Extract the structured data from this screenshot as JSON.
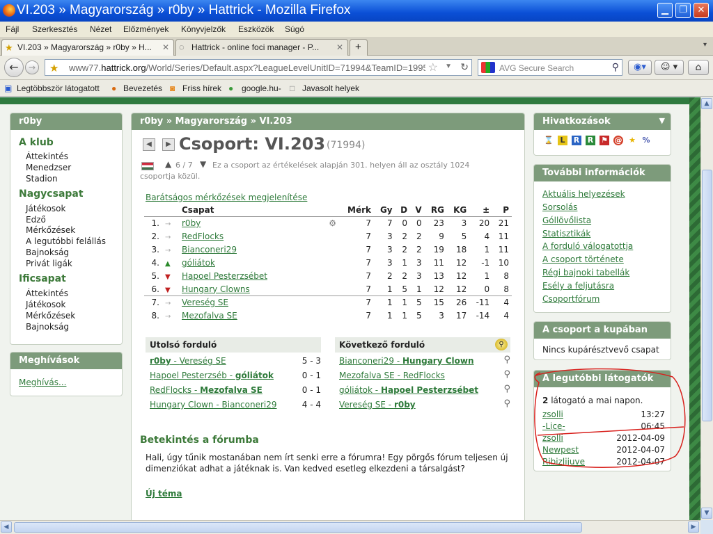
{
  "window": {
    "title": "VI.203 » Magyarország » r0by » Hattrick - Mozilla Firefox"
  },
  "menu": [
    "Fájl",
    "Szerkesztés",
    "Nézet",
    "Előzmények",
    "Könyvjelzők",
    "Eszközök",
    "Súgó"
  ],
  "tabs": [
    {
      "label": "VI.203 » Magyarország » r0by » H..."
    },
    {
      "label": "Hattrick - online foci manager - P..."
    }
  ],
  "nav": {
    "url_prefix": "www77.",
    "url_domain": "hattrick.org",
    "url_rest": "/World/Series/Default.aspx?LeagueLevelUnitID=71994&TeamID=19957",
    "search_placeholder": "AVG Secure Search"
  },
  "bookmarks": [
    "Legtöbbször látogatott",
    "Bevezetés",
    "Friss hírek",
    "google.hu-",
    "Javasolt helyek"
  ],
  "left": {
    "header": "r0by",
    "groups": [
      {
        "title": "A klub",
        "items": [
          "Áttekintés",
          "Menedzser",
          "Stadion"
        ]
      },
      {
        "title": "Nagycsapat",
        "items": [
          "Játékosok",
          "Edző",
          "Mérkőzések",
          "A legutóbbi felállás",
          "Bajnokság",
          "Privát ligák"
        ]
      },
      {
        "title": "Ificsapat",
        "items": [
          "Áttekintés",
          "Játékosok",
          "Mérkőzések",
          "Bajnokság"
        ]
      }
    ],
    "invites_header": "Meghívások",
    "invite_link": "Meghívás..."
  },
  "main": {
    "breadcrumb": "r0by  »  Magyarország  »  VI.203",
    "title": "Csoport: VI.203",
    "id": "(71994)",
    "rank_text": "6 / 7",
    "rank_desc_1": "Ez a csoport az értékelések alapján 301. helyen áll az osztály 1024",
    "rank_desc_2": "csoportja közül.",
    "friendly_link": "Barátságos mérkőzések megjelenítése",
    "headers": [
      "Csapat",
      "Mérk",
      "Gy",
      "D",
      "V",
      "RG",
      "KG",
      "±",
      "P"
    ],
    "rows": [
      {
        "pos": "1.",
        "team": "r0by",
        "m": "7",
        "w": "7",
        "d": "0",
        "l": "0",
        "gf": "23",
        "ga": "3",
        "diff": "20",
        "p": "21",
        "move": "same"
      },
      {
        "pos": "2.",
        "team": "RedFlocks",
        "m": "7",
        "w": "3",
        "d": "2",
        "l": "2",
        "gf": "9",
        "ga": "5",
        "diff": "4",
        "p": "11",
        "move": "same"
      },
      {
        "pos": "3.",
        "team": "Bianconeri29",
        "m": "7",
        "w": "3",
        "d": "2",
        "l": "2",
        "gf": "19",
        "ga": "18",
        "diff": "1",
        "p": "11",
        "move": "same"
      },
      {
        "pos": "4.",
        "team": "góliátok",
        "m": "7",
        "w": "3",
        "d": "1",
        "l": "3",
        "gf": "11",
        "ga": "12",
        "diff": "-1",
        "p": "10",
        "move": "up"
      },
      {
        "pos": "5.",
        "team": "Hapoel Pesterzsébet",
        "m": "7",
        "w": "2",
        "d": "2",
        "l": "3",
        "gf": "13",
        "ga": "12",
        "diff": "1",
        "p": "8",
        "move": "down"
      },
      {
        "pos": "6.",
        "team": "Hungary Clowns",
        "m": "7",
        "w": "1",
        "d": "5",
        "l": "1",
        "gf": "12",
        "ga": "12",
        "diff": "0",
        "p": "8",
        "move": "down"
      },
      {
        "pos": "7.",
        "team": "Vereség SE",
        "m": "7",
        "w": "1",
        "d": "1",
        "l": "5",
        "gf": "15",
        "ga": "26",
        "diff": "-11",
        "p": "4",
        "move": "same"
      },
      {
        "pos": "8.",
        "team": "Mezofalva SE",
        "m": "7",
        "w": "1",
        "d": "1",
        "l": "5",
        "gf": "3",
        "ga": "17",
        "diff": "-14",
        "p": "4",
        "move": "same"
      }
    ],
    "last_round": {
      "title": "Utolsó forduló",
      "matches": [
        {
          "home": "r0by",
          "away": "Vereség SE",
          "score": "5 - 3",
          "bold": "home"
        },
        {
          "home": "Hapoel Pesterzséb",
          "away": "góliátok",
          "score": "0 - 1",
          "bold": "away"
        },
        {
          "home": "RedFlocks",
          "away": "Mezofalva SE",
          "score": "0 - 1",
          "bold": "away"
        },
        {
          "home": "Hungary Clown",
          "away": "Bianconeri29",
          "score": "4 - 4",
          "bold": "none"
        }
      ]
    },
    "next_round": {
      "title": "Következő forduló",
      "matches": [
        {
          "home": "Bianconeri29",
          "away": "Hungary Clown",
          "bold": "away"
        },
        {
          "home": "Mezofalva SE",
          "away": "RedFlocks",
          "bold": "none"
        },
        {
          "home": "góliátok",
          "away": "Hapoel Pesterzsébet",
          "bold": "away"
        },
        {
          "home": "Vereség SE",
          "away": "r0by",
          "bold": "away"
        }
      ]
    },
    "forum_title": "Betekintés a fórumba",
    "forum_text_1": "Hali, úgy tűnik mostanában nem írt senki erre a fórumra! Egy pörgős fórum teljesen új",
    "forum_text_2": "dimenziókat adhat a játéknak is. Van kedved esetleg elkezdeni a társalgást?",
    "new_topic": "Új téma"
  },
  "right": {
    "links_header": "Hivatkozások",
    "info_header": "További információk",
    "info_links": [
      "Aktuális helyezések",
      "Sorsolás",
      "Góllövőlista",
      "Statisztikák",
      "A forduló válogatottja",
      "A csoport története",
      "Régi bajnoki tabellák",
      "Esély a feljutásra",
      "Csoportfórum"
    ],
    "cup_header": "A csoport a kupában",
    "cup_text": "Nincs kupárésztvevő csapat",
    "visitors_header": "A legutóbbi látogatók",
    "visitors_count": "2",
    "visitors_text": "látogató a mai napon.",
    "visitors_today": [
      {
        "name": "zsolli",
        "time": "13:27"
      },
      {
        "name": "-Lice-",
        "time": "06:45"
      }
    ],
    "visitors_past": [
      {
        "name": "zsolli",
        "time": "2012-04-09"
      },
      {
        "name": "Newpest",
        "time": "2012-04-07"
      },
      {
        "name": "Ribizlijuve",
        "time": "2012-04-07"
      }
    ]
  }
}
